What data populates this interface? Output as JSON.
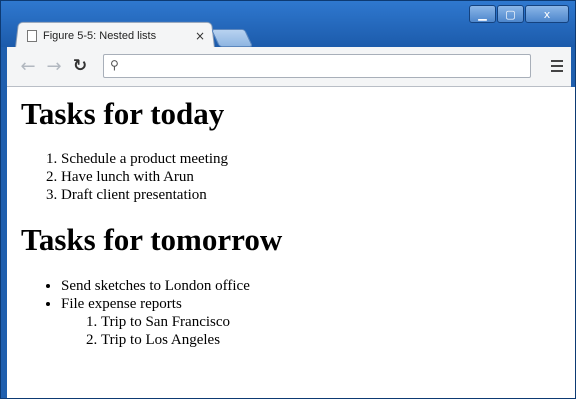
{
  "browser": {
    "tab_title": "Figure 5-5: Nested lists",
    "tab_close_glyph": "×",
    "address_value": "",
    "window_buttons": {
      "minimize": "▁",
      "maximize": "▢",
      "close": "x"
    },
    "icons": {
      "back": "back-arrow-icon",
      "forward": "forward-arrow-icon",
      "reload": "reload-icon",
      "search": "search-icon",
      "menu": "hamburger-menu-icon",
      "page": "page-icon"
    }
  },
  "page": {
    "heading_today": "Tasks for today",
    "today_items": [
      "Schedule a product meeting",
      "Have lunch with Arun",
      "Draft client presentation"
    ],
    "heading_tomorrow": "Tasks for tomorrow",
    "tomorrow_items": [
      "Send sketches to London office",
      "File expense reports"
    ],
    "expense_subitems": [
      "Trip to San Francisco",
      "Trip to Los Angeles"
    ]
  }
}
